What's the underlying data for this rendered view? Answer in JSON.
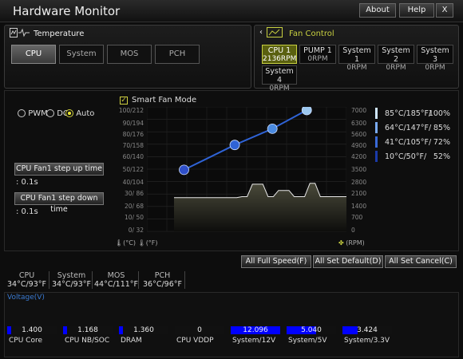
{
  "window": {
    "title": "Hardware Monitor",
    "buttons": {
      "about": "About",
      "help": "Help",
      "close": "X"
    }
  },
  "temperature": {
    "title": "Temperature",
    "tabs": [
      "CPU",
      "System",
      "MOS",
      "PCH"
    ],
    "active_tab": "CPU"
  },
  "fan_control": {
    "title": "Fan Control",
    "fans": [
      {
        "name": "CPU 1",
        "rpm": "2136RPM",
        "active": true
      },
      {
        "name": "PUMP 1",
        "rpm": "0RPM",
        "active": false
      },
      {
        "name": "System 1",
        "rpm": "0RPM",
        "active": false
      },
      {
        "name": "System 2",
        "rpm": "0RPM",
        "active": false
      },
      {
        "name": "System 3",
        "rpm": "0RPM",
        "active": false
      },
      {
        "name": "System 4",
        "rpm": "0RPM",
        "active": false
      }
    ]
  },
  "mode": {
    "options": [
      "PWM",
      "DC",
      "Auto"
    ],
    "selected": "Auto",
    "step_up_label": "CPU Fan1 step up time",
    "step_up_value": ": 0.1s",
    "step_down_label": "CPU Fan1 step down time",
    "step_down_value": ": 0.1s"
  },
  "smart_fan": {
    "label": "Smart Fan Mode",
    "enabled": true,
    "y_left_labels": [
      "100/212",
      "90/194",
      "80/176",
      "70/158",
      "60/140",
      "50/122",
      "40/104",
      "30/ 86",
      "20/ 68",
      "10/ 50",
      "0/ 32"
    ],
    "y_right_labels": [
      "7000",
      "6300",
      "5600",
      "4900",
      "4200",
      "3500",
      "2800",
      "2100",
      "1400",
      "700",
      "0"
    ],
    "x_unit_left": "(°C)",
    "x_unit_right": "(°F)",
    "rpm_unit": "(RPM)",
    "curve_points": [
      {
        "temp_c": 10,
        "pct": 52
      },
      {
        "temp_c": 41,
        "pct": 72
      },
      {
        "temp_c": 64,
        "pct": 85
      },
      {
        "temp_c": 85,
        "pct": 100
      }
    ],
    "rpm_history": [
      1900,
      1900,
      1900,
      1900,
      1900,
      1900,
      1900,
      1900,
      1900,
      1900,
      1900,
      1900,
      1900,
      1950,
      1950,
      2650,
      2650,
      2650,
      1950,
      1950,
      2300,
      2300,
      2300,
      1950,
      1950,
      1950,
      2700,
      2700,
      1950,
      1950,
      1950,
      1950,
      1950,
      1950
    ],
    "legend": [
      {
        "temp": "85°C/185°F/",
        "pct": "100%",
        "color": "#cfe6ff"
      },
      {
        "temp": "64°C/147°F/",
        "pct": "85%",
        "color": "#7aaaf0"
      },
      {
        "temp": "41°C/105°F/",
        "pct": "72%",
        "color": "#3a6ad8"
      },
      {
        "temp": "10°C/50°F/",
        "pct": "52%",
        "color": "#1a3aa8"
      }
    ]
  },
  "actions": {
    "full_speed": "All Full Speed(F)",
    "set_default": "All Set Default(D)",
    "set_cancel": "All Set Cancel(C)"
  },
  "sensors": [
    {
      "name": "CPU",
      "value": "34°C/93°F"
    },
    {
      "name": "System",
      "value": "34°C/93°F"
    },
    {
      "name": "MOS",
      "value": "44°C/111°F"
    },
    {
      "name": "PCH",
      "value": "36°C/96°F"
    }
  ],
  "voltage": {
    "title": "Voltage(V)",
    "items": [
      {
        "name": "CPU Core",
        "value": "1.400",
        "fill": 0.05
      },
      {
        "name": "CPU NB/SOC",
        "value": "1.168",
        "fill": 0.05
      },
      {
        "name": "DRAM",
        "value": "1.360",
        "fill": 0.05
      },
      {
        "name": "CPU VDDP",
        "value": "0",
        "fill": 0.0
      },
      {
        "name": "System/12V",
        "value": "12.096",
        "fill": 1.0
      },
      {
        "name": "System/5V",
        "value": "5.040",
        "fill": 0.6
      },
      {
        "name": "System/3.3V",
        "value": "3.424",
        "fill": 0.3
      }
    ]
  },
  "colors": {
    "accent": "#d0d040",
    "curve": "#2f63d6",
    "voltage_bar": "#0000ff",
    "voltage_title": "#3a7ad0"
  }
}
